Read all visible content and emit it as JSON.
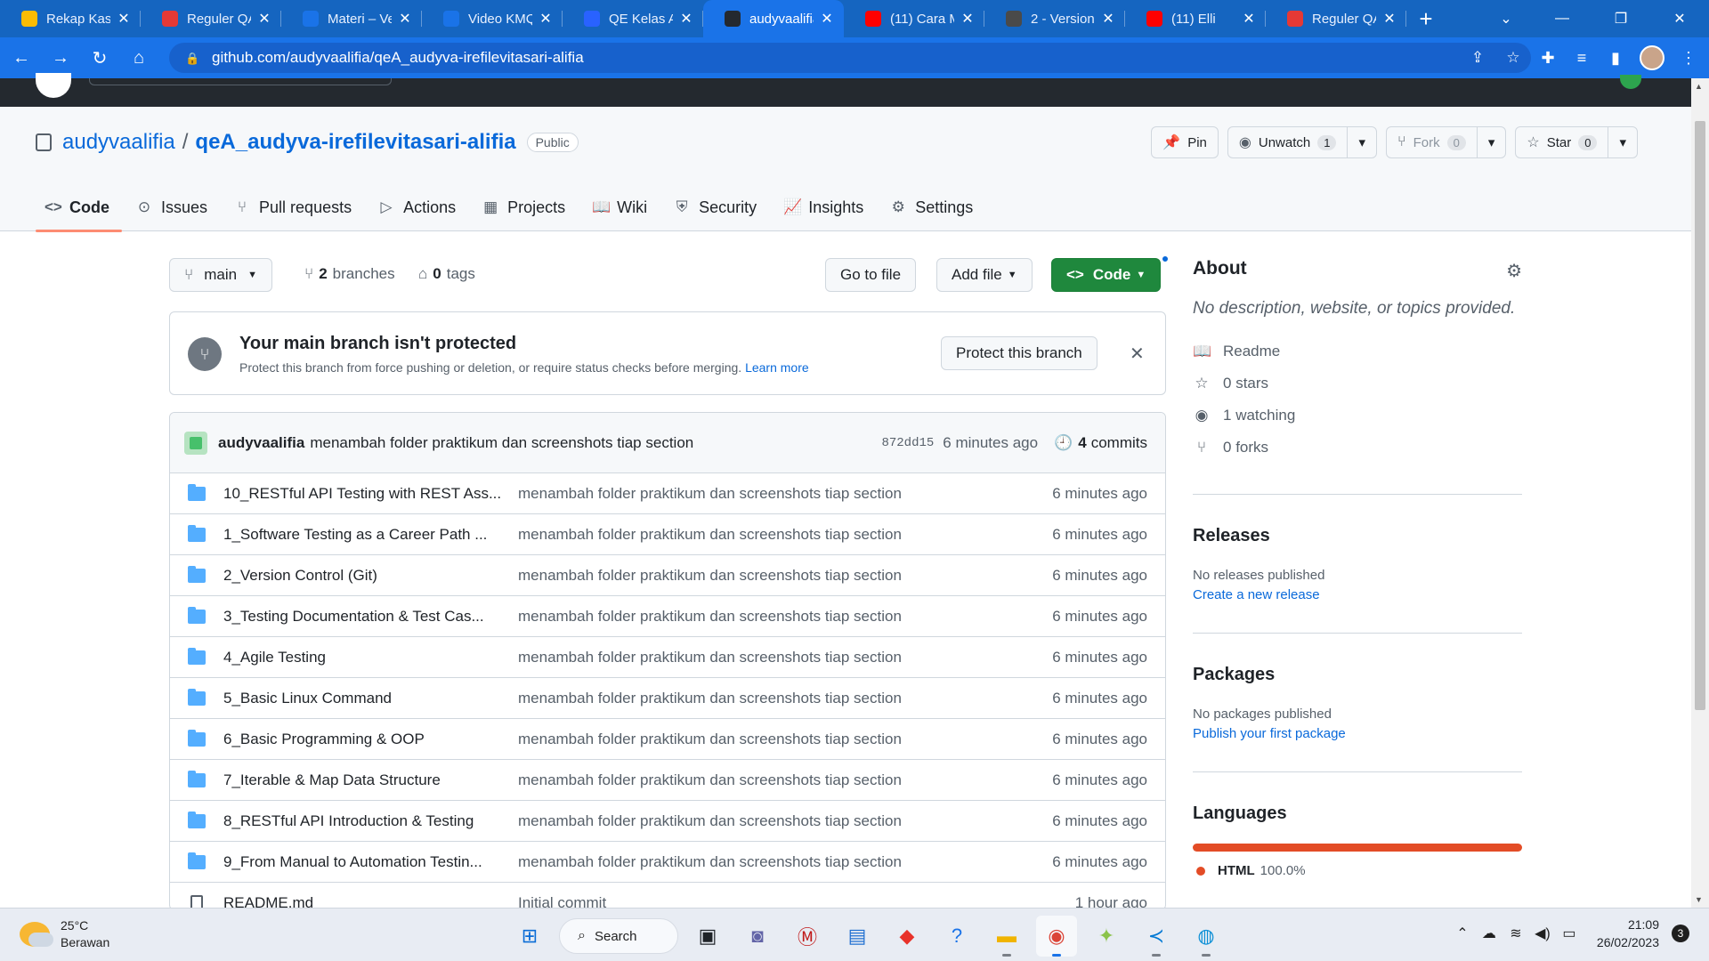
{
  "browser": {
    "tabs": [
      {
        "title": "Rekap Kas -",
        "favicon_color": "#fbbc04",
        "favicon": "drive-icon"
      },
      {
        "title": "Reguler QA",
        "favicon_color": "#e53935",
        "favicon": "doc-icon"
      },
      {
        "title": "Materi – Ve",
        "favicon_color": "#1a73e8",
        "favicon": "notion-icon"
      },
      {
        "title": "Video KMQ",
        "favicon_color": "#1a73e8",
        "favicon": "notion-icon"
      },
      {
        "title": "QE Kelas A",
        "favicon_color": "#2962ff",
        "favicon": "zoom-icon"
      },
      {
        "title": "audyvaalifia",
        "favicon_color": "#24292f",
        "favicon": "github-icon",
        "active": true
      },
      {
        "title": "(11) Cara M",
        "favicon_color": "#ff0000",
        "favicon": "youtube-icon"
      },
      {
        "title": "2 - Version",
        "favicon_color": "#4a4a4a",
        "favicon": "doc-icon"
      },
      {
        "title": "(11) Elli",
        "favicon_color": "#ff0000",
        "favicon": "youtube-icon"
      },
      {
        "title": "Reguler QA",
        "favicon_color": "#e53935",
        "favicon": "doc-icon"
      }
    ],
    "url": "github.com/audyvaalifia/qeA_audyva-irefilevitasari-alifia"
  },
  "repo": {
    "owner": "audyvaalifia",
    "name": "qeA_audyva-irefilevitasari-alifia",
    "visibility": "Public",
    "actions": {
      "pin": "Pin",
      "unwatch": "Unwatch",
      "watch_count": "1",
      "fork": "Fork",
      "fork_count": "0",
      "star": "Star",
      "star_count": "0"
    },
    "tabs": [
      {
        "label": "Code",
        "icon": "code-icon",
        "glyph": "<>"
      },
      {
        "label": "Issues",
        "icon": "issues-icon",
        "glyph": "⊙"
      },
      {
        "label": "Pull requests",
        "icon": "pull-request-icon",
        "glyph": "⑂"
      },
      {
        "label": "Actions",
        "icon": "actions-icon",
        "glyph": "▷"
      },
      {
        "label": "Projects",
        "icon": "projects-icon",
        "glyph": "▦"
      },
      {
        "label": "Wiki",
        "icon": "wiki-icon",
        "glyph": "📖"
      },
      {
        "label": "Security",
        "icon": "security-icon",
        "glyph": "⛨"
      },
      {
        "label": "Insights",
        "icon": "insights-icon",
        "glyph": "📈"
      },
      {
        "label": "Settings",
        "icon": "settings-icon",
        "glyph": "⚙"
      }
    ]
  },
  "toolbar": {
    "branch": "main",
    "branches_count": "2",
    "branches_label": "branches",
    "tags_count": "0",
    "tags_label": "tags",
    "go_to_file": "Go to file",
    "add_file": "Add file",
    "code": "Code"
  },
  "protect_banner": {
    "title": "Your main branch isn't protected",
    "desc": "Protect this branch from force pushing or deletion, or require status checks before merging.",
    "learn_more": "Learn more",
    "button": "Protect this branch"
  },
  "latest_commit": {
    "user": "audyvaalifia",
    "message": "menambah folder praktikum dan screenshots tiap section",
    "sha": "872dd15",
    "time": "6 minutes ago",
    "commits_count": "4",
    "commits_label": "commits"
  },
  "files": [
    {
      "type": "dir",
      "name": "10_RESTful API Testing with REST Ass...",
      "message": "menambah folder praktikum dan screenshots tiap section",
      "time": "6 minutes ago"
    },
    {
      "type": "dir",
      "name": "1_Software Testing as a Career Path ...",
      "message": "menambah folder praktikum dan screenshots tiap section",
      "time": "6 minutes ago"
    },
    {
      "type": "dir",
      "name": "2_Version Control (Git)",
      "message": "menambah folder praktikum dan screenshots tiap section",
      "time": "6 minutes ago"
    },
    {
      "type": "dir",
      "name": "3_Testing Documentation & Test Cas...",
      "message": "menambah folder praktikum dan screenshots tiap section",
      "time": "6 minutes ago"
    },
    {
      "type": "dir",
      "name": "4_Agile Testing",
      "message": "menambah folder praktikum dan screenshots tiap section",
      "time": "6 minutes ago"
    },
    {
      "type": "dir",
      "name": "5_Basic Linux Command",
      "message": "menambah folder praktikum dan screenshots tiap section",
      "time": "6 minutes ago"
    },
    {
      "type": "dir",
      "name": "6_Basic Programming & OOP",
      "message": "menambah folder praktikum dan screenshots tiap section",
      "time": "6 minutes ago"
    },
    {
      "type": "dir",
      "name": "7_Iterable & Map Data Structure",
      "message": "menambah folder praktikum dan screenshots tiap section",
      "time": "6 minutes ago"
    },
    {
      "type": "dir",
      "name": "8_RESTful API Introduction & Testing",
      "message": "menambah folder praktikum dan screenshots tiap section",
      "time": "6 minutes ago"
    },
    {
      "type": "dir",
      "name": "9_From Manual to Automation Testin...",
      "message": "menambah folder praktikum dan screenshots tiap section",
      "time": "6 minutes ago"
    },
    {
      "type": "file",
      "name": "README.md",
      "message": "Initial commit",
      "time": "1 hour ago"
    }
  ],
  "about": {
    "heading": "About",
    "description": "No description, website, or topics provided.",
    "readme": "Readme",
    "stars_count": "0",
    "stars_label": "stars",
    "watching_count": "1",
    "watching_label": "watching",
    "forks_count": "0",
    "forks_label": "forks"
  },
  "releases": {
    "heading": "Releases",
    "empty": "No releases published",
    "link": "Create a new release"
  },
  "packages": {
    "heading": "Packages",
    "empty": "No packages published",
    "link": "Publish your first package"
  },
  "languages": {
    "heading": "Languages",
    "items": [
      {
        "name": "HTML",
        "percent": "100.0%",
        "color": "#e34c26",
        "fraction": 1.0
      }
    ]
  },
  "taskbar": {
    "temperature": "25°C",
    "weather": "Berawan",
    "search": "Search",
    "time": "21:09",
    "date": "26/02/2023",
    "notifications": "3"
  },
  "colors": {
    "accent": "#1a73e8",
    "code_button": "#1f883d",
    "link": "#0969da",
    "tab_underline": "#fd8c73"
  }
}
